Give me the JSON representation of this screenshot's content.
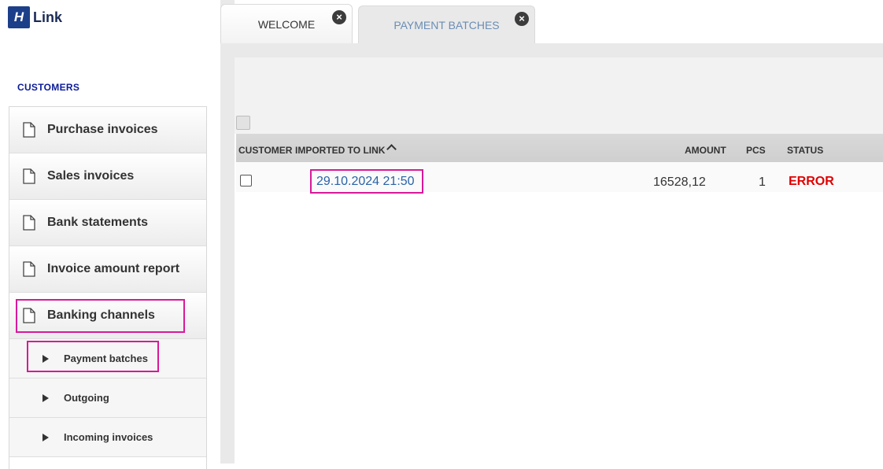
{
  "app": {
    "logo_mark": "H",
    "logo_text": "Link"
  },
  "sidebar": {
    "section_label": "CUSTOMERS",
    "items": [
      {
        "label": "Purchase invoices"
      },
      {
        "label": "Sales invoices"
      },
      {
        "label": "Bank statements"
      },
      {
        "label": "Invoice amount report"
      },
      {
        "label": "Banking channels"
      }
    ],
    "sub_items": [
      {
        "label": "Payment batches"
      },
      {
        "label": "Outgoing"
      },
      {
        "label": "Incoming invoices"
      }
    ]
  },
  "tabs": [
    {
      "label": "WELCOME",
      "close": "×"
    },
    {
      "label": "PAYMENT BATCHES",
      "close": "×"
    }
  ],
  "table": {
    "columns": {
      "customer": "CUSTOMER",
      "imported": "IMPORTED TO LINK",
      "amount": "AMOUNT",
      "pcs": "PCS",
      "status": "STATUS"
    },
    "rows": [
      {
        "imported": "29.10.2024 21:50",
        "amount": "16528,12",
        "pcs": "1",
        "status": "ERROR"
      }
    ]
  },
  "colors": {
    "brand": "#1c3f8a",
    "highlight": "#d8199a",
    "error": "#e00000",
    "link": "#2a63a8"
  }
}
